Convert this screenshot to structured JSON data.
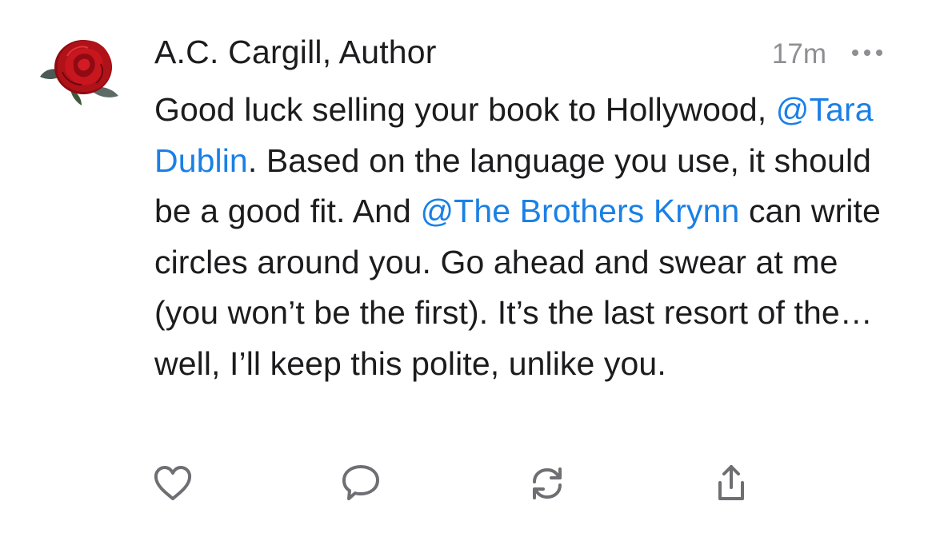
{
  "note": {
    "author": "A.C. Cargill, Author",
    "timestamp": "17m",
    "body": {
      "t1": "Good luck selling your book to Hollywood, ",
      "mention1": "@Tara Dublin",
      "t2": ". Based on the language you use, it should be a good fit. And ",
      "mention2": "@The Brothers Krynn",
      "t3": " can write circles around you. Go ahead and swear at me (you won’t be the first). It’s the last resort of the… well, I’ll keep this polite, unlike you."
    }
  },
  "icons": {
    "avatar": "rose-avatar",
    "more": "more-horizontal-icon",
    "like": "heart-icon",
    "reply": "comment-bubble-icon",
    "restack": "restack-icon",
    "share": "share-icon"
  },
  "colors": {
    "text": "#1c1c1e",
    "mention": "#1a80e6",
    "muted": "#8e8e93",
    "icon": "#6e6e73"
  }
}
